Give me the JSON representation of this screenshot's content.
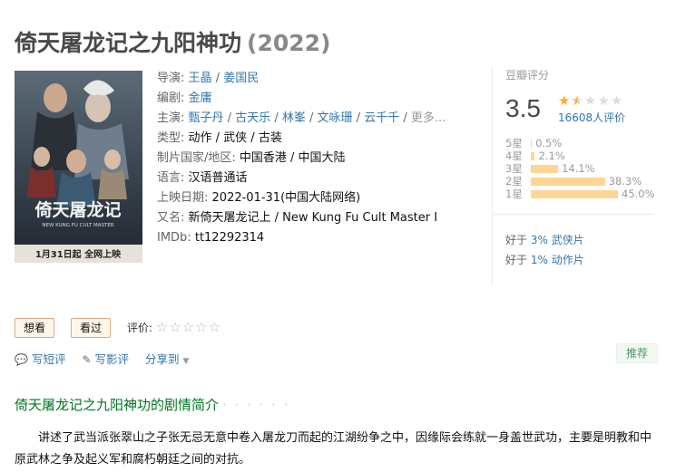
{
  "movie": {
    "title": "倚天屠龙记之九阳神功",
    "year": "(2022)"
  },
  "poster": {
    "banner_text": "1月31日起 全网上映",
    "sub_text": "NEW KUNG FU CULT MASTER",
    "calligraphy": "倚天屠龙记"
  },
  "info": {
    "director_label": "导演: ",
    "directors": [
      "王晶",
      "姜国民"
    ],
    "writer_label": "编剧: ",
    "writers": [
      "金庸"
    ],
    "cast_label": "主演: ",
    "cast": [
      "甄子丹",
      "古天乐",
      "林峯",
      "文咏珊",
      "云千千"
    ],
    "cast_more": "更多...",
    "genre_label": "类型:",
    "genre": "动作 / 武侠 / 古装",
    "country_label": "制片国家/地区:",
    "country": "中国香港 / 中国大陆",
    "language_label": "语言:",
    "language": "汉语普通话",
    "release_label": "上映日期:",
    "release": "2022-01-31(中国大陆网络)",
    "aka_label": "又名:",
    "aka": "新倚天屠龙记上 / New Kung Fu Cult Master Ⅰ",
    "imdb_label": "IMDb:",
    "imdb": "tt12292314"
  },
  "rating": {
    "header": "豆瓣评分",
    "score": "3.5",
    "stars_filled": 1.5,
    "votes": "16608人评价",
    "distribution": [
      {
        "label": "5星",
        "pct": "0.5%",
        "value": 0.5
      },
      {
        "label": "4星",
        "pct": "2.1%",
        "value": 2.1
      },
      {
        "label": "3星",
        "pct": "14.1%",
        "value": 14.1
      },
      {
        "label": "2星",
        "pct": "38.3%",
        "value": 38.3
      },
      {
        "label": "1星",
        "pct": "45.0%",
        "value": 45.0
      }
    ],
    "better_than": [
      {
        "prefix": "好于 ",
        "pct": "3%",
        "genre": "武侠片"
      },
      {
        "prefix": "好于 ",
        "pct": "1%",
        "genre": "动作片"
      }
    ]
  },
  "user_actions": {
    "want": "想看",
    "watched": "看过",
    "rate_label": "评价:",
    "write_short": "写短评",
    "write_review": "写影评",
    "share": "分享到",
    "recommend": "推荐"
  },
  "summary": {
    "title": "倚天屠龙记之九阳神功的剧情简介",
    "dots": "· · · · · ·",
    "text": "讲述了武当派张翠山之子张无忌无意中卷入屠龙刀而起的江湖纷争之中，因缘际会练就一身盖世武功，主要是明教和中原武林之争及起义军和腐朽朝廷之间的对抗。"
  },
  "colors": {
    "link": "#3377aa",
    "star": "#ffac2d",
    "bar": "#ffd596",
    "summary_title": "#007722"
  }
}
